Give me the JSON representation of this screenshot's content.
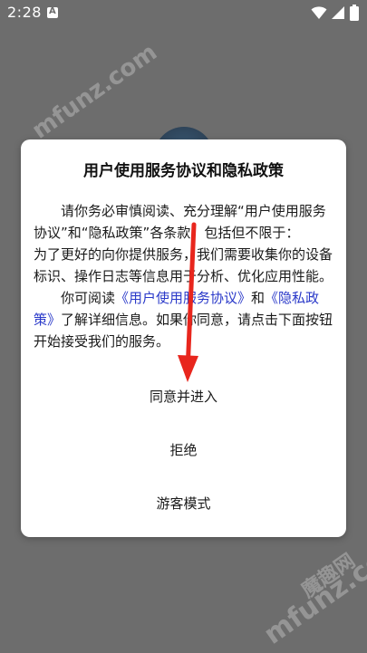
{
  "status_bar": {
    "time": "2:28",
    "icons": [
      "notification-a-icon",
      "wifi-icon",
      "signal-icon",
      "battery-icon"
    ]
  },
  "watermark": {
    "text": "mfunz.com",
    "brand": "魔趣网"
  },
  "dialog": {
    "title": "用户使用服务协议和隐私政策",
    "intro_p1": "请你务必审慎阅读、充分理解“用户使用服务协议”和“隐私政策”各条款，包括但不限于：",
    "intro_p2": "为了更好的向你提供服务，我们需要收集你的设备标识、操作日志等信息用于分析、优化应用性能。",
    "read_prefix": "你可阅读",
    "link_service": "《用户使用服务协议》",
    "read_and": "和",
    "link_privacy": "《隐私政策》",
    "read_suffix": "了解详细信息。如果你同意，请点击下面按钮开始接受我们的服务。",
    "agree_label": "同意并进入",
    "refuse_label": "拒绝",
    "guest_label": "游客模式"
  },
  "colors": {
    "overlay": "#6d6d6d",
    "dialog_bg": "#ffffff",
    "link": "#2a39c9",
    "annotation_arrow": "#e8261d"
  }
}
